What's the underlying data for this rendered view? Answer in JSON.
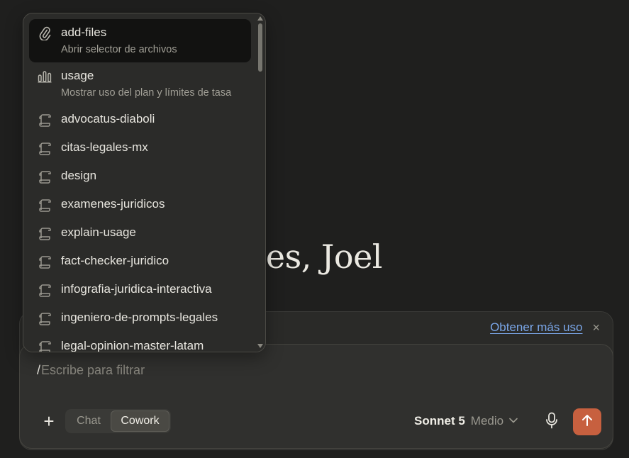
{
  "greeting": {
    "text": "as noches, Joel"
  },
  "banner": {
    "link_label": "Obtener más uso",
    "close_symbol": "×"
  },
  "composer": {
    "slash": "/",
    "placeholder": "Escribe para filtrar",
    "plus_symbol": "+",
    "modes": [
      {
        "label": "Chat",
        "active": false
      },
      {
        "label": "Cowork",
        "active": true
      }
    ],
    "model_name": "Sonnet 5",
    "effort": "Medio",
    "chevron": "⌄",
    "send_color": "#c7603f"
  },
  "menu": {
    "items": [
      {
        "title": "add-files",
        "desc": "Abrir selector de archivos",
        "icon": "paperclip-icon",
        "selected": true
      },
      {
        "title": "usage",
        "desc": "Mostrar uso del plan y límites de tasa",
        "icon": "bar-chart-icon",
        "selected": false
      },
      {
        "title": "advocatus-diaboli",
        "icon": "scroll-icon"
      },
      {
        "title": "citas-legales-mx",
        "icon": "scroll-icon"
      },
      {
        "title": "design",
        "icon": "scroll-icon"
      },
      {
        "title": "examenes-juridicos",
        "icon": "scroll-icon"
      },
      {
        "title": "explain-usage",
        "icon": "scroll-icon"
      },
      {
        "title": "fact-checker-juridico",
        "icon": "scroll-icon"
      },
      {
        "title": "infografia-juridica-interactiva",
        "icon": "scroll-icon"
      },
      {
        "title": "ingeniero-de-prompts-legales",
        "icon": "scroll-icon"
      },
      {
        "title": "legal-opinion-master-latam",
        "icon": "scroll-icon"
      }
    ]
  },
  "colors": {
    "background": "#1f1f1e",
    "accent": "#c7603f",
    "link": "#7aa6e8"
  }
}
